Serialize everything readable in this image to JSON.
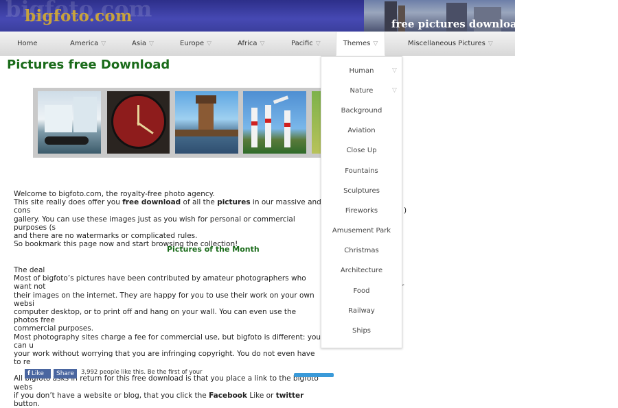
{
  "header": {
    "logo_text": "bigfoto.com",
    "ghost_text": "bigfoto.com",
    "banner_text": "free pictures download"
  },
  "nav": [
    {
      "label": "Home",
      "arrow": ""
    },
    {
      "label": "America",
      "arrow": "▽"
    },
    {
      "label": "Asia",
      "arrow": "▽"
    },
    {
      "label": "Europe",
      "arrow": "▽"
    },
    {
      "label": "Africa",
      "arrow": "▽"
    },
    {
      "label": "Pacific",
      "arrow": "▽"
    },
    {
      "label": "Themes",
      "arrow": "▽",
      "active": true
    },
    {
      "label": "Miscellaneous Pictures",
      "arrow": "▽"
    }
  ],
  "page_title": "Pictures free Download",
  "themes_menu": [
    {
      "label": "Human",
      "arrow": "▽"
    },
    {
      "label": "Nature",
      "arrow": "▽"
    },
    {
      "label": "Background"
    },
    {
      "label": "Aviation"
    },
    {
      "label": "Close Up"
    },
    {
      "label": "Fountains"
    },
    {
      "label": "Sculptures"
    },
    {
      "label": "Fireworks"
    },
    {
      "label": "Amusement Park"
    },
    {
      "label": "Christmas"
    },
    {
      "label": "Architecture"
    },
    {
      "label": "Food"
    },
    {
      "label": "Railway"
    },
    {
      "label": "Ships"
    }
  ],
  "intro": {
    "line1": "Welcome to bigfoto.com, the royalty-free photo agency.",
    "line2_a": "This site really does offer you ",
    "line2_b": "free download",
    "line2_c": " of all the ",
    "line2_d": "pictures",
    "line2_e": " in our massive and cons",
    "line3": "gallery. You can use these images just as you wish for personal or commercial purposes (s",
    "line3_tail": ")",
    "line4": "and there are no watermarks or complicated rules.",
    "line5": "So bookmark this page now and start browsing the collection!"
  },
  "section_title": "Pictures of the Month",
  "deal": {
    "l1": "The deal",
    "l2": "Most of bigfoto’s pictures have been contributed by amateur photographers who want not",
    "l3": "their images on the internet. They are happy for you to use their work on your own websi",
    "l3_tail": "r",
    "l4": "computer desktop, or to print off and hang on your wall. You can even use the photos free",
    "l5": "commercial purposes.",
    "l6": "Most photography sites charge a fee for commercial use, but bigfoto is different: you can u",
    "l7": "your work without worrying that you are infringing copyright. You do not even have to re",
    "l8": "All bigfoto asks in return for this free download is that you place a link to the bigfoto webs",
    "l9_a": "if you don’t have a website or blog, that you click the ",
    "l9_b": "Facebook",
    "l9_c": " Like or ",
    "l9_d": "twitter",
    "l9_e": " button."
  },
  "social": {
    "like_label": "Like",
    "share_label": "Share",
    "like_text": "3,992 people like this. Be the first of your"
  }
}
